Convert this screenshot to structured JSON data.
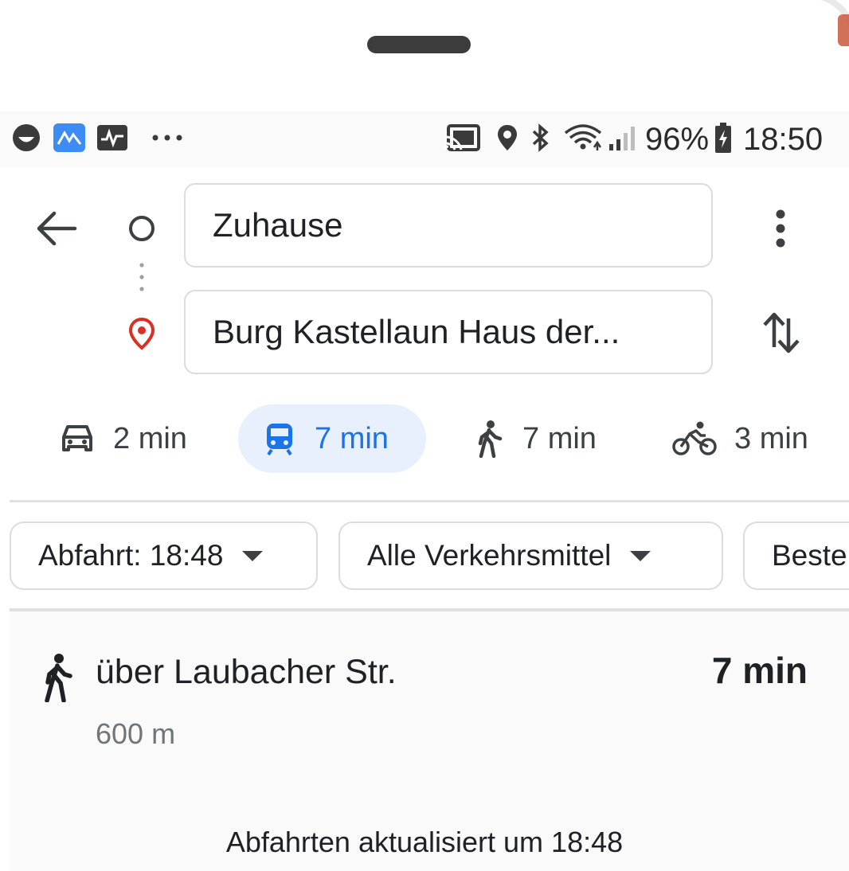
{
  "status_bar": {
    "left_icons": [
      "circle-face-icon",
      "app-mountain-icon",
      "app-chart-icon",
      "more-notifications-icon"
    ],
    "right_icons": [
      "cast-icon",
      "location-icon",
      "bluetooth-icon",
      "wifi-icon",
      "signal-icon",
      "battery-charging-icon"
    ],
    "battery": "96%",
    "time": "18:50"
  },
  "search": {
    "origin": "Zuhause",
    "destination": "Burg Kastellaun Haus der..."
  },
  "modes": [
    {
      "icon": "car-icon",
      "label": "2 min"
    },
    {
      "icon": "train-icon",
      "label": "7 min",
      "selected": true
    },
    {
      "icon": "walk-icon",
      "label": "7 min"
    },
    {
      "icon": "bike-icon",
      "label": "3 min"
    }
  ],
  "filters": {
    "departure": "Abfahrt: 18:48",
    "transport": "Alle Verkehrsmittel",
    "best": "Beste"
  },
  "result": {
    "title": "über Laubacher Str.",
    "time": "7 min",
    "distance": "600 m"
  },
  "footer": {
    "updated": "Abfahrten aktualisiert um 18:48"
  },
  "colors": {
    "accent": "#1a73e8",
    "accent_bg": "#e8f0fe",
    "pin_red": "#d93025"
  }
}
